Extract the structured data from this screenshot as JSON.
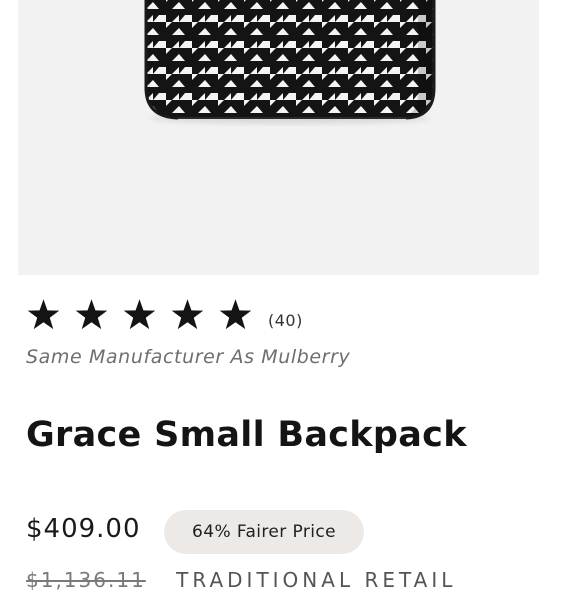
{
  "product": {
    "image_alt": "houndstooth backpack",
    "rating": {
      "stars": 5,
      "max_stars": 5,
      "review_count": "(40)"
    },
    "manufacturer_note": "Same Manufacturer As Mulberry",
    "title": "Grace Small Backpack",
    "price": "$409.00",
    "fairer_price_badge": "64% Fairer Price",
    "retail_price": "$1,136.11",
    "retail_label": "TRADITIONAL RETAIL"
  },
  "colors": {
    "image_background": "#f2f2f2",
    "badge_background": "#ece9e6",
    "star": "#141414",
    "muted_text": "#6e6e6e"
  },
  "icons": {
    "rating": "star-icon"
  }
}
